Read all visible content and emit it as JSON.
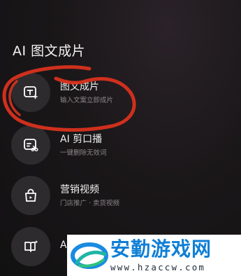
{
  "header": {
    "title": "AI 图文成片"
  },
  "menu": {
    "items": [
      {
        "title": "图文成片",
        "subtitle": "输入文案立即成片",
        "icon": "text-to-video-icon"
      },
      {
        "title": "AI 剪口播",
        "subtitle": "一键删除无效词",
        "icon": "ai-cut-icon"
      },
      {
        "title": "营销视频",
        "subtitle": "门店推广 · 卖货视频",
        "icon": "shopping-bag-icon"
      },
      {
        "title": "A",
        "subtitle": "",
        "icon": "book-sparkle-icon"
      }
    ]
  },
  "annotation": {
    "color": "#d8321e"
  },
  "watermark": {
    "name": "安勤游戏网",
    "url": "www.hzaccw.com",
    "color": "#0f7fd6"
  }
}
